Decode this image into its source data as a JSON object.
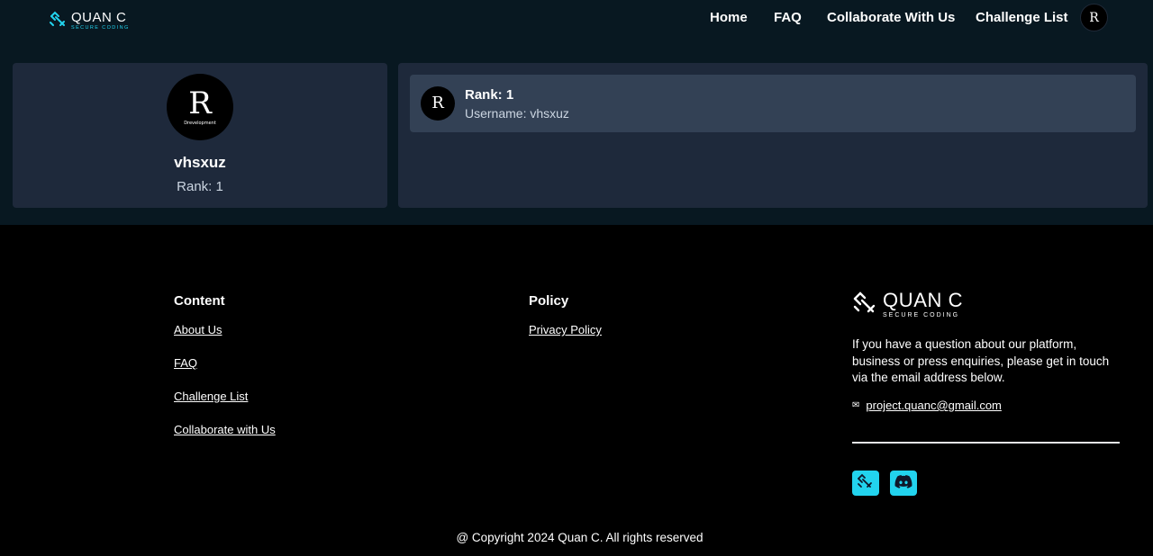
{
  "header": {
    "brand": {
      "name": "QUAN C",
      "tagline": "SECURE CODING"
    },
    "nav": [
      {
        "label": "Home"
      },
      {
        "label": "FAQ"
      },
      {
        "label": "Collaborate With Us"
      },
      {
        "label": "Challenge List"
      }
    ],
    "avatar_logo": {
      "letters": "R"
    }
  },
  "profile": {
    "avatar_logo": {
      "letters": "R",
      "sub": "Drevelopment"
    },
    "username": "vhsxuz",
    "rank": "Rank: 1"
  },
  "leaderboard": {
    "rows": [
      {
        "rank": "Rank: 1",
        "username": "Username: vhsxuz",
        "avatar_logo": {
          "letters": "R"
        }
      }
    ]
  },
  "footer": {
    "content": {
      "title": "Content",
      "links": [
        "About Us",
        "FAQ",
        "Challenge List",
        "Collaborate with Us"
      ]
    },
    "policy": {
      "title": "Policy",
      "links": [
        "Privacy Policy"
      ]
    },
    "brand": {
      "name": "QUAN C",
      "tagline": "SECURE CODING"
    },
    "contact_text": "If you have a question about our platform, business or press enquiries, please get in touch via the email address below.",
    "email": "project.quanc@gmail.com",
    "social": [
      {
        "icon": "quanc-logo-icon"
      },
      {
        "icon": "discord-icon"
      }
    ],
    "copyright": "@ Copyright 2024 Quan C. All rights reserved"
  },
  "colors": {
    "header_bg": "#081821",
    "card_bg": "#1e293b",
    "row_bg": "#334155",
    "accent": "#22d3ee",
    "footer_bg": "#000000"
  }
}
